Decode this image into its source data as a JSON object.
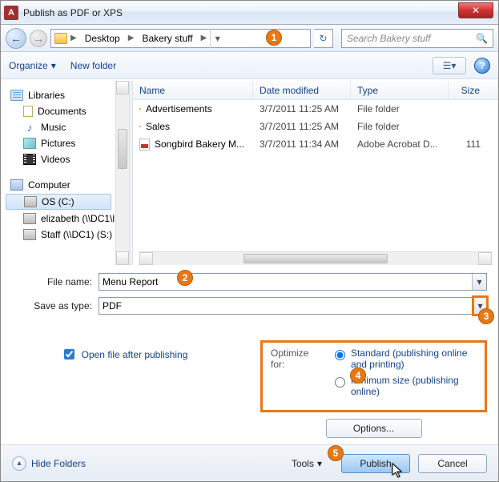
{
  "window": {
    "title": "Publish as PDF or XPS"
  },
  "nav": {
    "crumbs": [
      "Desktop",
      "Bakery stuff"
    ],
    "search_placeholder": "Search Bakery stuff"
  },
  "toolbar": {
    "organize": "Organize",
    "new_folder": "New folder"
  },
  "tree": {
    "libraries": "Libraries",
    "documents": "Documents",
    "music": "Music",
    "pictures": "Pictures",
    "videos": "Videos",
    "computer": "Computer",
    "os": "OS (C:)",
    "elizabeth": "elizabeth (\\\\DC1\\l",
    "staff": "Staff (\\\\DC1) (S:)"
  },
  "columns": {
    "name": "Name",
    "date": "Date modified",
    "type": "Type",
    "size": "Size"
  },
  "files": [
    {
      "name": "Advertisements",
      "date": "3/7/2011 11:25 AM",
      "type": "File folder",
      "size": "",
      "icon": "folder"
    },
    {
      "name": "Sales",
      "date": "3/7/2011 11:25 AM",
      "type": "File folder",
      "size": "",
      "icon": "folder"
    },
    {
      "name": "Songbird Bakery M...",
      "date": "3/7/2011 11:34 AM",
      "type": "Adobe Acrobat D...",
      "size": "111",
      "icon": "pdf"
    }
  ],
  "form": {
    "file_name_label": "File name:",
    "file_name_value": "Menu Report",
    "save_type_label": "Save as type:",
    "save_type_value": "PDF"
  },
  "publish": {
    "open_after": "Open file after publishing",
    "optimize_label": "Optimize for:",
    "standard": "Standard (publishing online and printing)",
    "minimum": "Minimum size (publishing online)",
    "options_btn": "Options..."
  },
  "footer": {
    "hide_folders": "Hide Folders",
    "tools": "Tools",
    "publish": "Publish",
    "cancel": "Cancel"
  },
  "annotations": [
    "1",
    "2",
    "3",
    "4",
    "5"
  ]
}
